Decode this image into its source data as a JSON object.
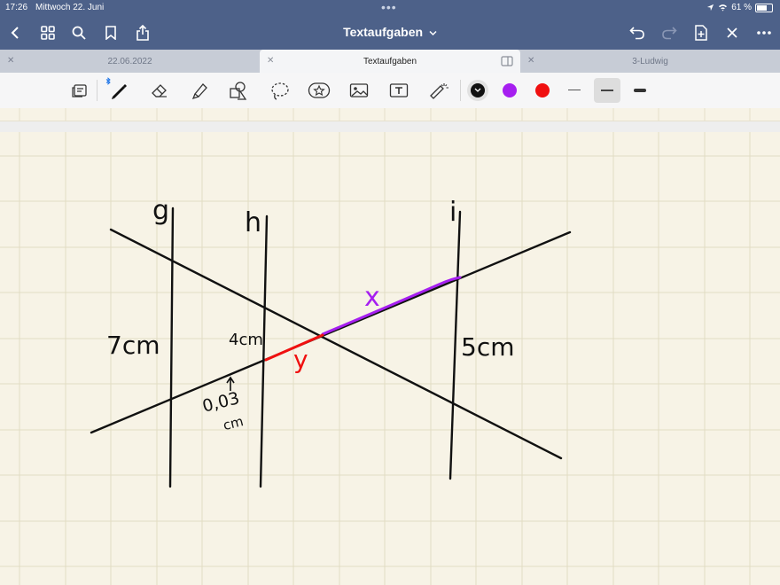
{
  "status": {
    "time": "17:26",
    "date": "Mittwoch 22. Juni",
    "battery": "61 %"
  },
  "nav": {
    "title": "Textaufgaben"
  },
  "tabs": [
    {
      "label": "22.06.2022",
      "active": false
    },
    {
      "label": "Textaufgaben",
      "active": true
    },
    {
      "label": "3-Ludwig",
      "active": false
    }
  ],
  "colors": {
    "bar": "#4d6189",
    "black": "#111111",
    "purple": "#a61ff0",
    "red": "#f01010"
  },
  "drawing": {
    "line_labels": [
      "g",
      "h",
      "i"
    ],
    "seg_7cm": "7cm",
    "seg_4cm": "4cm",
    "seg_5cm": "5cm",
    "var_x": "x",
    "var_y": "y",
    "note_value": "0,03",
    "note_unit": "cm"
  }
}
